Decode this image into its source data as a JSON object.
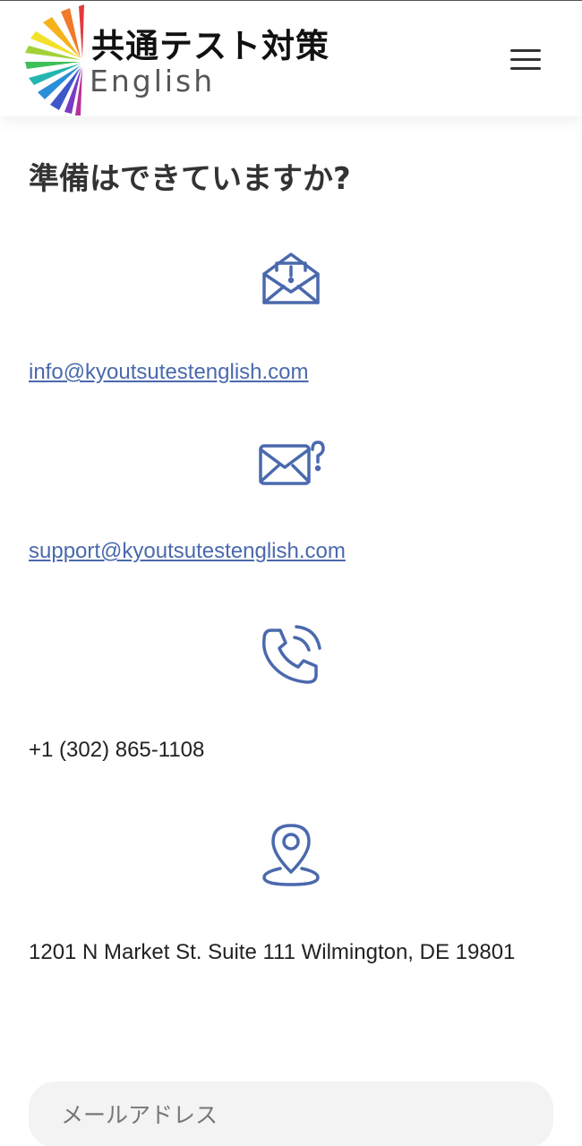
{
  "header": {
    "logo_title": "共通テスト対策",
    "logo_subtitle": "English",
    "menu_icon": "hamburger-menu-icon"
  },
  "contact": {
    "heading": "準備はできていますか?",
    "info_email_icon": "envelope-alert-icon",
    "info_email": "info@kyoutsutestenglish.com",
    "support_email_icon": "envelope-question-icon",
    "support_email": "support@kyoutsutestenglish.com",
    "phone_icon": "phone-ringing-icon",
    "phone": "+1 (302) 865-1108",
    "location_icon": "map-pin-icon",
    "address": "1201 N Market St. Suite 111 Wilmington, DE 19801"
  },
  "form": {
    "email_placeholder": "メールアドレス"
  },
  "colors": {
    "accent": "#4a69ad",
    "text": "#222222",
    "input_bg": "#f3f3f3"
  }
}
